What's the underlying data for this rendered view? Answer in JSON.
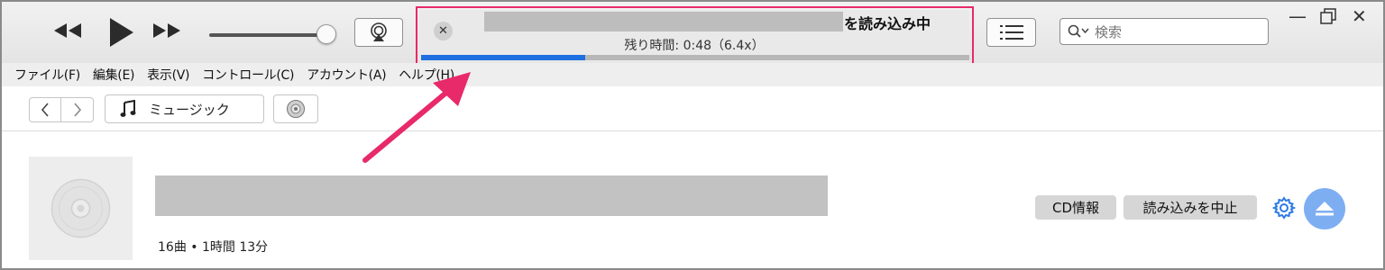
{
  "toolbar": {
    "lcd": {
      "status_suffix": "を読み込み中",
      "time_remaining": "残り時間: 0:48（6.4x）",
      "progress_fraction": 0.3
    },
    "search": {
      "placeholder": "検索"
    }
  },
  "menubar": {
    "items": [
      "ファイル(F)",
      "編集(E)",
      "表示(V)",
      "コントロール(C)",
      "アカウント(A)",
      "ヘルプ(H)"
    ]
  },
  "nav": {
    "media_selector": "ミュージック"
  },
  "album": {
    "meta": "16曲 • 1時間 13分",
    "cd_info_label": "CD情報",
    "stop_import_label": "読み込みを中止"
  },
  "colors": {
    "accent_blue": "#1e6fe0",
    "highlight": "#e8296a",
    "eject": "#7eaef2"
  }
}
